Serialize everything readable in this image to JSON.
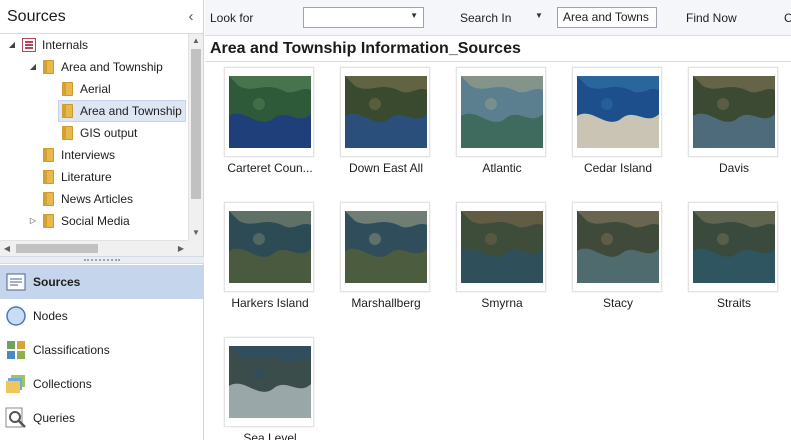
{
  "left_panel": {
    "title": "Sources",
    "collapse_glyph": "‹",
    "tree": [
      {
        "label": "Internals",
        "level": 0,
        "expanded": true,
        "icon": "internals-icon"
      },
      {
        "label": "Area and Township",
        "level": 1,
        "expanded": true,
        "icon": "folder-icon"
      },
      {
        "label": "Aerial",
        "level": 2,
        "icon": "folder-icon"
      },
      {
        "label": "Area and Township",
        "level": 2,
        "icon": "folder-icon",
        "selected": true
      },
      {
        "label": "GIS output",
        "level": 2,
        "icon": "folder-icon"
      },
      {
        "label": "Interviews",
        "level": 1,
        "icon": "folder-icon"
      },
      {
        "label": "Literature",
        "level": 1,
        "icon": "folder-icon"
      },
      {
        "label": "News Articles",
        "level": 1,
        "icon": "folder-icon"
      },
      {
        "label": "Social Media",
        "level": 1,
        "collapsed": true,
        "icon": "folder-icon"
      }
    ],
    "nav": [
      {
        "label": "Sources",
        "icon": "sources-icon",
        "active": true
      },
      {
        "label": "Nodes",
        "icon": "nodes-icon"
      },
      {
        "label": "Classifications",
        "icon": "classifications-icon"
      },
      {
        "label": "Collections",
        "icon": "collections-icon"
      },
      {
        "label": "Queries",
        "icon": "queries-icon"
      }
    ]
  },
  "find_bar": {
    "look_for_label": "Look for",
    "look_for_value": "",
    "search_in_label": "Search In",
    "search_in_value": "Area and Towns",
    "find_now_label": "Find Now",
    "clear_label": "C"
  },
  "content": {
    "title": "Area and Township Information_Sources",
    "items": [
      {
        "caption": "Carteret  Coun...",
        "palette": [
          "#2f5a3a",
          "#1e3f7a",
          "#4f7a52"
        ]
      },
      {
        "caption": "Down East All",
        "palette": [
          "#3a4a2e",
          "#2a4f7a",
          "#6b6a48"
        ]
      },
      {
        "caption": "Atlantic",
        "palette": [
          "#5b7f8f",
          "#3f6b5e",
          "#8e9a8a"
        ]
      },
      {
        "caption": "Cedar Island",
        "palette": [
          "#1c4f8c",
          "#c9c4b3",
          "#2d6b9f"
        ]
      },
      {
        "caption": "Davis",
        "palette": [
          "#3c4a33",
          "#4d6b7a",
          "#6e6b4e"
        ]
      },
      {
        "caption": "Harkers Island",
        "palette": [
          "#2d4b54",
          "#4a5a3e",
          "#6c7a6a"
        ]
      },
      {
        "caption": "Marshallberg",
        "palette": [
          "#2f4d5a",
          "#4b5c3f",
          "#7f8a7a"
        ]
      },
      {
        "caption": "Smyrna",
        "palette": [
          "#3e4d3a",
          "#2f4f5a",
          "#6b6048"
        ]
      },
      {
        "caption": "Stacy",
        "palette": [
          "#3f4a3a",
          "#506b6e",
          "#756b55"
        ]
      },
      {
        "caption": "Straits",
        "palette": [
          "#3a4b3e",
          "#2f5560",
          "#6a6b55"
        ]
      },
      {
        "caption": "Sea Level",
        "palette": [
          "#3b4d4a",
          "#9aa7a8",
          "#2f4f62"
        ]
      }
    ]
  }
}
